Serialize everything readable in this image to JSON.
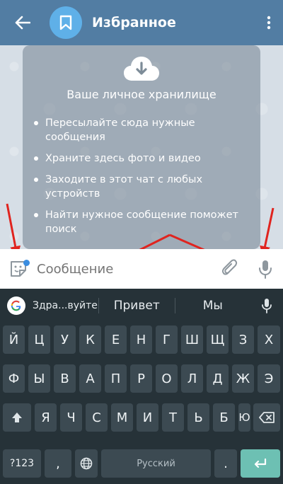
{
  "header": {
    "title": "Избранное"
  },
  "info_card": {
    "title": "Ваше личное хранилище",
    "items": [
      "Пересылайте сюда нужные сообщения",
      "Храните здесь фото и видео",
      "Заходите в этот чат с любых устройств",
      "Найти нужное сообщение поможет поиск"
    ]
  },
  "composer": {
    "placeholder": "Сообщение"
  },
  "keyboard": {
    "suggestions": [
      "Здра...вуйте",
      "Привет",
      "Мы"
    ],
    "row1": [
      "Й",
      "Ц",
      "У",
      "К",
      "Е",
      "Н",
      "Г",
      "Ш",
      "Щ",
      "З",
      "Х"
    ],
    "row2": [
      "Ф",
      "Ы",
      "В",
      "А",
      "П",
      "Р",
      "О",
      "Л",
      "Д",
      "Ж",
      "Э"
    ],
    "row3": [
      "Я",
      "Ч",
      "С",
      "М",
      "И",
      "Т",
      "Ь",
      "Б",
      "Ю"
    ],
    "sym_label": "?123",
    "comma": ",",
    "space_label": "Русский",
    "period": "."
  },
  "colors": {
    "header": "#527da3",
    "accent": "#5fb0e8",
    "arrow": "#e0241f",
    "keyboard_bg": "#263238",
    "key_bg": "#3c4a52",
    "enter_key": "#6dc0b3"
  },
  "icons": [
    "back-arrow-icon",
    "bookmark-icon",
    "more-vert-icon",
    "cloud-download-icon",
    "sticker-icon",
    "paperclip-icon",
    "microphone-icon",
    "google-g-icon",
    "shift-icon",
    "backspace-icon",
    "globe-icon",
    "enter-icon"
  ]
}
